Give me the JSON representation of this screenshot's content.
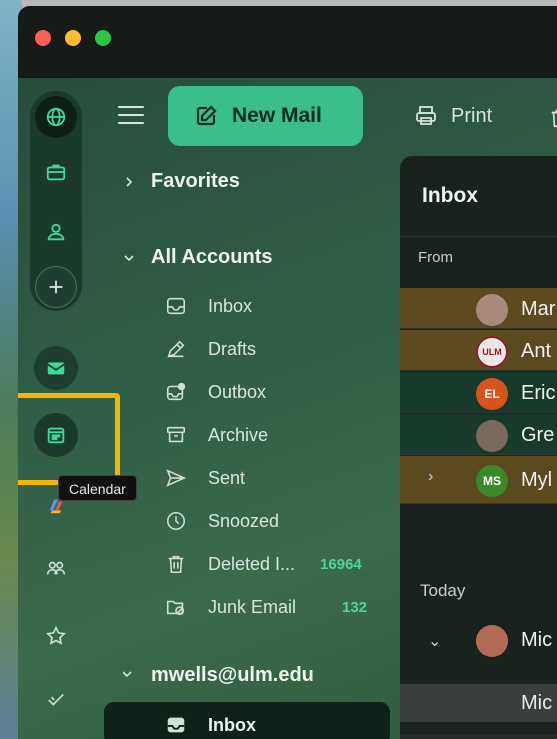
{
  "toolbar": {
    "new_mail_label": "New Mail",
    "print_label": "Print"
  },
  "tooltip": {
    "calendar": "Calendar"
  },
  "folders": {
    "favorites": "Favorites",
    "all_accounts": "All Accounts",
    "items": [
      {
        "label": "Inbox",
        "icon": "inbox-icon"
      },
      {
        "label": "Drafts",
        "icon": "pencil-icon"
      },
      {
        "label": "Outbox",
        "icon": "outbox-icon"
      },
      {
        "label": "Archive",
        "icon": "archive-icon"
      },
      {
        "label": "Sent",
        "icon": "send-icon"
      },
      {
        "label": "Snoozed",
        "icon": "clock-icon"
      },
      {
        "label": "Deleted I...",
        "icon": "trash-icon",
        "count": "16964"
      },
      {
        "label": "Junk Email",
        "icon": "junk-icon",
        "count": "132"
      }
    ],
    "account": "mwells@ulm.edu",
    "account_inbox": "Inbox"
  },
  "list": {
    "title": "Inbox",
    "from_header": "From",
    "today_label": "Today",
    "rows": [
      {
        "name": "Mar",
        "avatar": ""
      },
      {
        "name": "Ant",
        "avatar": "ULM"
      },
      {
        "name": "Eric",
        "avatar": "EL"
      },
      {
        "name": "Gre",
        "avatar": ""
      },
      {
        "name": "Myl",
        "avatar": "MS"
      },
      {
        "name": "Mic",
        "avatar": ""
      }
    ],
    "selected_row": "Mic"
  },
  "colors": {
    "accent": "#3bbf8a",
    "highlight": "#f6b500"
  }
}
